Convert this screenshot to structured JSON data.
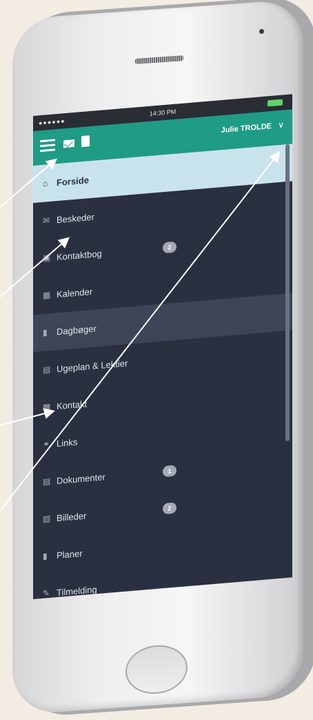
{
  "phone": {
    "status": {
      "signal": "●●●●●●",
      "time": "14:30 PM"
    },
    "header": {
      "user_name": "Julie TROLDE",
      "chevron": "∨"
    },
    "menu": [
      {
        "label": "Forside",
        "icon": "home-icon",
        "glyph": "⌂",
        "state": "active"
      },
      {
        "label": "Beskeder",
        "icon": "mail-icon",
        "glyph": "✉"
      },
      {
        "label": "Kontaktbog",
        "icon": "contact-book-icon",
        "glyph": "▣",
        "badge": "2"
      },
      {
        "label": "Kalender",
        "icon": "calendar-icon",
        "glyph": "▦"
      },
      {
        "label": "Dagbøger",
        "icon": "diary-icon",
        "glyph": "▮",
        "state": "highlight"
      },
      {
        "label": "Ugeplan & Lektier",
        "icon": "weekplan-icon",
        "glyph": "▤"
      },
      {
        "label": "Kontakt",
        "icon": "contact-icon",
        "glyph": "▩"
      },
      {
        "label": "Links",
        "icon": "link-icon",
        "glyph": "⚭"
      },
      {
        "label": "Dokumenter",
        "icon": "document-icon",
        "glyph": "▤",
        "badge": "1"
      },
      {
        "label": "Billeder",
        "icon": "image-icon",
        "glyph": "▧",
        "badge": "2"
      },
      {
        "label": "Planer",
        "icon": "clipboard-icon",
        "glyph": "▮"
      },
      {
        "label": "Tilmelding",
        "icon": "signup-icon",
        "glyph": "✎"
      }
    ]
  },
  "colors": {
    "header": "#1f9b86",
    "menu_background": "#2b3040",
    "active_item": "#c9e3ec",
    "page_background": "#f3ece2"
  }
}
